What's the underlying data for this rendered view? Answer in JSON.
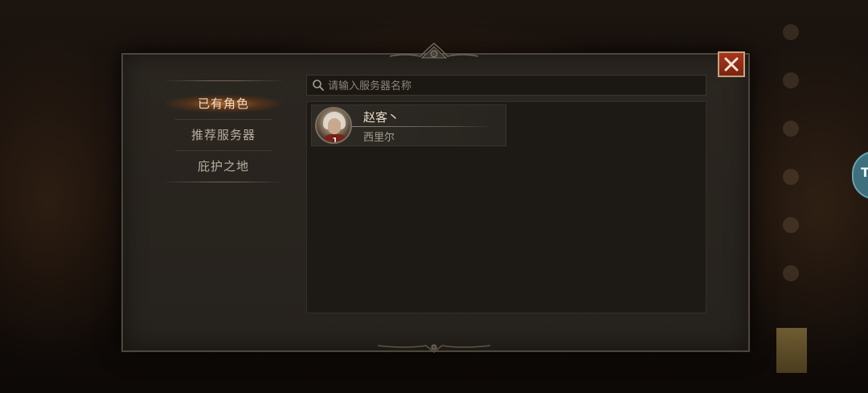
{
  "search": {
    "placeholder": "请输入服务器名称"
  },
  "nav": {
    "items": [
      {
        "label": "已有角色",
        "active": true
      },
      {
        "label": "推荐服务器",
        "active": false
      },
      {
        "label": "庇护之地",
        "active": false
      }
    ]
  },
  "characters": [
    {
      "name": "赵客丶",
      "server": "西里尔",
      "level": "1"
    }
  ],
  "side_tab": {
    "label": "T"
  },
  "colors": {
    "accent_active": "#d2782d",
    "close_button": "#a8351f",
    "text_primary": "#e8dccb",
    "panel_bg": "#2b2620"
  }
}
